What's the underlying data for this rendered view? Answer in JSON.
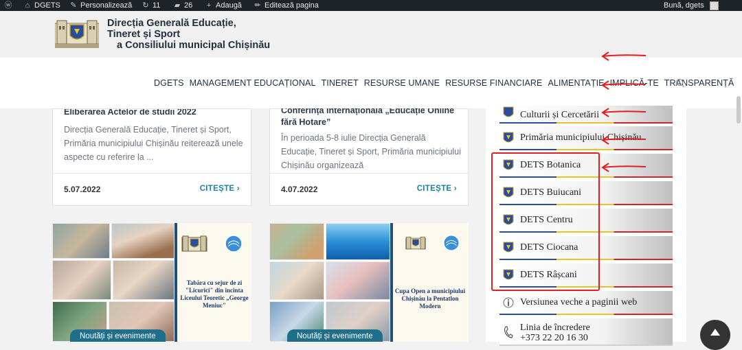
{
  "adminbar": {
    "site": "DGETS",
    "customize": "Personalizează",
    "updates": "11",
    "comments": "26",
    "add": "Adaugă",
    "edit": "Editează pagina",
    "greeting": "Bună, dgets"
  },
  "header": {
    "title_line1": "Direcția Generală Educație,",
    "title_line2": "Tineret și Sport",
    "title_line3": "a Consiliului municipal Chișinău"
  },
  "nav": {
    "items": [
      "DGETS",
      "MANAGEMENT EDUCAȚIONAL",
      "TINERET",
      "RESURSE UMANE",
      "RESURSE FINANCIARE",
      "ALIMENTAȚIE",
      "IMPLICĂ-TE",
      "TRANSPARENȚĂ"
    ]
  },
  "cards": [
    {
      "title": "Eliberarea Actelor de studii 2022",
      "excerpt": "Direcția Generală Educație, Tineret și Sport, Primăria municipiului Chișinău reiterează unele aspecte cu referire la ...",
      "date": "5.07.2022",
      "more": "CITEȘTE ›"
    },
    {
      "title": "Conferința internațională „Educație Online fără Hotare”",
      "excerpt": "În perioada 5-8 iulie Direcția Generală Educație, Tineret și Sport, Primăria municipiului Chișinău organizează",
      "date": "4.07.2022",
      "more": "CITEȘTE ›"
    }
  ],
  "image_posts": [
    {
      "poster_text": "Tabăra cu sejur de zi \"Licurici\" din incinta Liceului Teoretic „George Meniuc\"",
      "badge": "Noutăți și evenimente"
    },
    {
      "poster_text": "Cupa Open a municipiului Chișinău la Pentatlon Modern",
      "badge": "Noutăți și evenimente"
    }
  ],
  "sidebar": {
    "top_partial": "Culturii și Cercetării",
    "items": [
      "Primăria municipiului Chișinău",
      "DETS Botanica",
      "DETS Buiucani",
      "DETS Centru",
      "DETS Ciocana",
      "DETS Râșcani",
      "Versiunea veche a paginii web"
    ],
    "trust_label": "Linia de încredere",
    "trust_phone": "+373 22 20 16 30"
  },
  "colors": {
    "accent": "#1f7ea8",
    "badge": "#1f6f8b",
    "highlight": "#e02020",
    "adminbar": "#1d2327"
  }
}
